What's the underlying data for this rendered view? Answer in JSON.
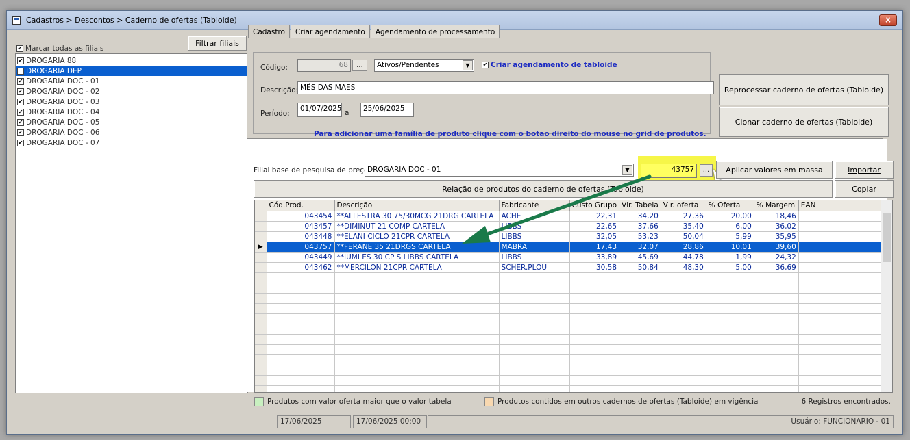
{
  "window": {
    "title": "Cadastros > Descontos > Caderno de ofertas (Tabloide)",
    "close_icon": "×"
  },
  "left_panel": {
    "filter_button": "Filtrar filiais",
    "select_all_label": "Marcar todas as filiais",
    "branches": [
      {
        "name": "DROGARIA 88",
        "checked": true,
        "selected": false
      },
      {
        "name": "DROGARIA DEP",
        "checked": false,
        "selected": true
      },
      {
        "name": "DROGARIA DOC - 01",
        "checked": true,
        "selected": false
      },
      {
        "name": "DROGARIA DOC - 02",
        "checked": true,
        "selected": false
      },
      {
        "name": "DROGARIA DOC - 03",
        "checked": true,
        "selected": false
      },
      {
        "name": "DROGARIA DOC - 04",
        "checked": true,
        "selected": false
      },
      {
        "name": "DROGARIA DOC - 05",
        "checked": true,
        "selected": false
      },
      {
        "name": "DROGARIA DOC - 06",
        "checked": true,
        "selected": false
      },
      {
        "name": "DROGARIA DOC - 07",
        "checked": true,
        "selected": false
      }
    ]
  },
  "tabs": [
    {
      "label": "Cadastro",
      "active": true
    },
    {
      "label": "Criar agendamento",
      "active": false
    },
    {
      "label": "Agendamento de processamento",
      "active": false
    }
  ],
  "form": {
    "codigo_label": "Código:",
    "codigo_value": "68",
    "lookup_button": "...",
    "status_value": "Ativos/Pendentes",
    "criar_agendamento_label": "Criar agendamento de tabloide",
    "descricao_label": "Descrição:",
    "descricao_value": "MÊS DAS MAES",
    "periodo_label": "Período:",
    "periodo_inicio": "01/07/2025",
    "periodo_sep": "a",
    "periodo_fim": "25/06/2025",
    "hint": "Para adicionar uma família de produto clique com o botão direito do  mouse no grid de produtos.",
    "reprocessar_button": "Reprocessar caderno de ofertas (Tabloide)",
    "clonar_button": "Clonar caderno de ofertas (Tabloide)"
  },
  "pricing": {
    "filial_base_label": "Filial base de pesquisa de preço",
    "filial_base_value": "DROGARIA DOC - 01",
    "product_code_value": "43757",
    "product_lookup_button": "...",
    "aplicar_button": "Aplicar valores em massa",
    "importar_button": "Importar",
    "copiar_button": "Copiar",
    "relacao_label": "Relação de produtos do caderno de ofertas (Tabloide)"
  },
  "grid": {
    "columns": [
      "Cód.Prod.",
      "Descrição",
      "Fabricante",
      "Custo Grupo",
      "Vlr. Tabela",
      "Vlr. oferta",
      "% Oferta",
      "% Margem",
      "EAN"
    ],
    "rows": [
      {
        "cod": "043454",
        "desc": "**ALLESTRA 30 75/30MCG 21DRG CARTELA",
        "fab": "ACHE",
        "custo": "22,31",
        "tabela": "34,20",
        "oferta": "27,36",
        "pct_oferta": "20,00",
        "margem": "18,46",
        "ean": ""
      },
      {
        "cod": "043457",
        "desc": "**DIMINUT 21 COMP CARTELA",
        "fab": "LIBBS",
        "custo": "22,65",
        "tabela": "37,66",
        "oferta": "35,40",
        "pct_oferta": "6,00",
        "margem": "36,02",
        "ean": ""
      },
      {
        "cod": "043448",
        "desc": "**ELANI CICLO 21CPR CARTELA",
        "fab": "LIBBS",
        "custo": "32,05",
        "tabela": "53,23",
        "oferta": "50,04",
        "pct_oferta": "5,99",
        "margem": "35,95",
        "ean": ""
      },
      {
        "cod": "043757",
        "desc": "**FERANE 35 21DRGS CARTELA",
        "fab": "MABRA",
        "custo": "17,43",
        "tabela": "32,07",
        "oferta": "28,86",
        "pct_oferta": "10,01",
        "margem": "39,60",
        "ean": ""
      },
      {
        "cod": "043449",
        "desc": "**IUMI ES 30 CP S LIBBS CARTELA",
        "fab": "LIBBS",
        "custo": "33,89",
        "tabela": "45,69",
        "oferta": "44,78",
        "pct_oferta": "1,99",
        "margem": "24,32",
        "ean": ""
      },
      {
        "cod": "043462",
        "desc": "**MERCILON 21CPR CARTELA",
        "fab": "SCHER.PLOU",
        "custo": "30,58",
        "tabela": "50,84",
        "oferta": "48,30",
        "pct_oferta": "5,00",
        "margem": "36,69",
        "ean": ""
      }
    ],
    "selected_row": 3,
    "row_pointer": "▶"
  },
  "legend": {
    "green_label": "Produtos com valor oferta maior que o valor tabela",
    "green_color": "#c8f0c0",
    "orange_label": "Produtos contidos em outros cadernos de ofertas (Tabloide) em vigência",
    "orange_color": "#f8d8b0",
    "records": "6 Registros encontrados."
  },
  "statusbar": {
    "date": "17/06/2025",
    "datetime": "17/06/2025 00:00",
    "user": "Usuário: FUNCIONARIO - 01"
  },
  "colors": {
    "highlight": "#f5f528",
    "arrow": "#1a7a4a",
    "selection": "#0a5fcf"
  }
}
